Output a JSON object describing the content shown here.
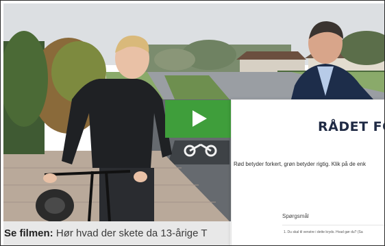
{
  "video": {
    "play_icon": "play-icon",
    "accent_color": "#3f9e3b"
  },
  "caption": {
    "bold": "Se filmen:",
    "text": " Hør hvad der skete da 13-årige T"
  },
  "document": {
    "title": "RÅDET FOR",
    "intro": "Rød betyder forkert, grøn betyder rigtig. Klik på de enk",
    "section_heading": "Spørgsmål",
    "question_1": "1. Du skal til venstre i dette kryds. Hvad gør du? (Sa"
  }
}
